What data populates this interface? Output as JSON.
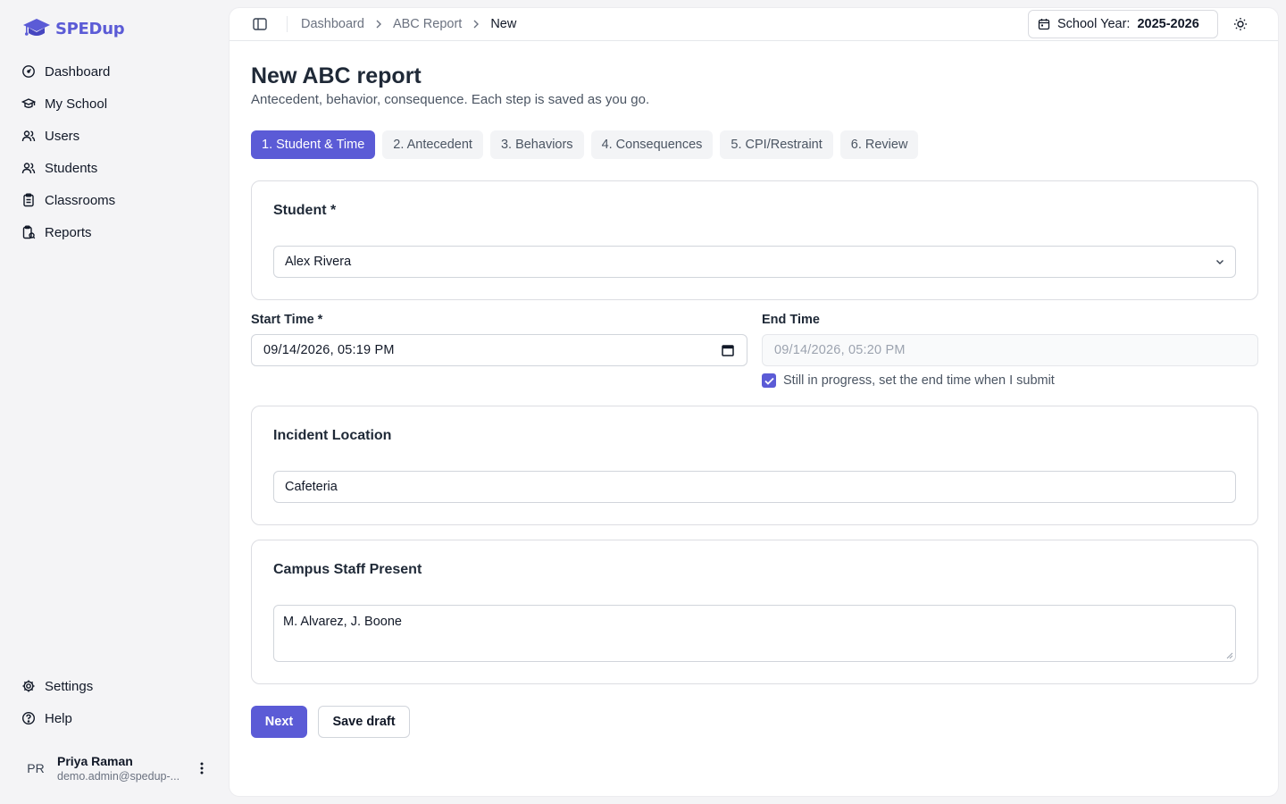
{
  "brand": {
    "name": "SPEDup",
    "color": "#5b5bd6"
  },
  "sidebar": {
    "items": [
      {
        "label": "Dashboard",
        "icon": "dashboard-icon"
      },
      {
        "label": "My School",
        "icon": "graduation-cap-icon"
      },
      {
        "label": "Users",
        "icon": "users-icon"
      },
      {
        "label": "Students",
        "icon": "students-icon"
      },
      {
        "label": "Classrooms",
        "icon": "clipboard-icon"
      },
      {
        "label": "Reports",
        "icon": "report-icon"
      }
    ],
    "bottom_items": [
      {
        "label": "Settings",
        "icon": "gear-icon"
      },
      {
        "label": "Help",
        "icon": "help-circle-icon"
      }
    ],
    "user": {
      "initials": "PR",
      "name": "Priya Raman",
      "email": "demo.admin@spedup-..."
    }
  },
  "topbar": {
    "breadcrumb": [
      "Dashboard",
      "ABC Report",
      "New"
    ],
    "school_year_label": "School Year:",
    "school_year_value": "2025-2026"
  },
  "page": {
    "title": "New ABC report",
    "subtitle": "Antecedent, behavior, consequence. Each step is saved as you go."
  },
  "steps": [
    {
      "label": "1. Student & Time",
      "active": true
    },
    {
      "label": "2. Antecedent",
      "active": false
    },
    {
      "label": "3. Behaviors",
      "active": false
    },
    {
      "label": "4. Consequences",
      "active": false
    },
    {
      "label": "5. CPI/Restraint",
      "active": false
    },
    {
      "label": "6. Review",
      "active": false
    }
  ],
  "form": {
    "student": {
      "label": "Student *",
      "value": "Alex Rivera"
    },
    "start_time": {
      "label": "Start Time *",
      "value": "09/14/2026, 05:19  PM"
    },
    "end_time": {
      "label": "End Time",
      "value": "09/14/2026, 05:20  PM"
    },
    "in_progress": {
      "label": "Still in progress, set the end time when I submit",
      "checked": true
    },
    "location": {
      "label": "Incident Location",
      "value": "Cafeteria"
    },
    "staff": {
      "label": "Campus Staff Present",
      "value": "M. Alvarez, J. Boone"
    }
  },
  "actions": {
    "next": "Next",
    "save_draft": "Save draft"
  }
}
